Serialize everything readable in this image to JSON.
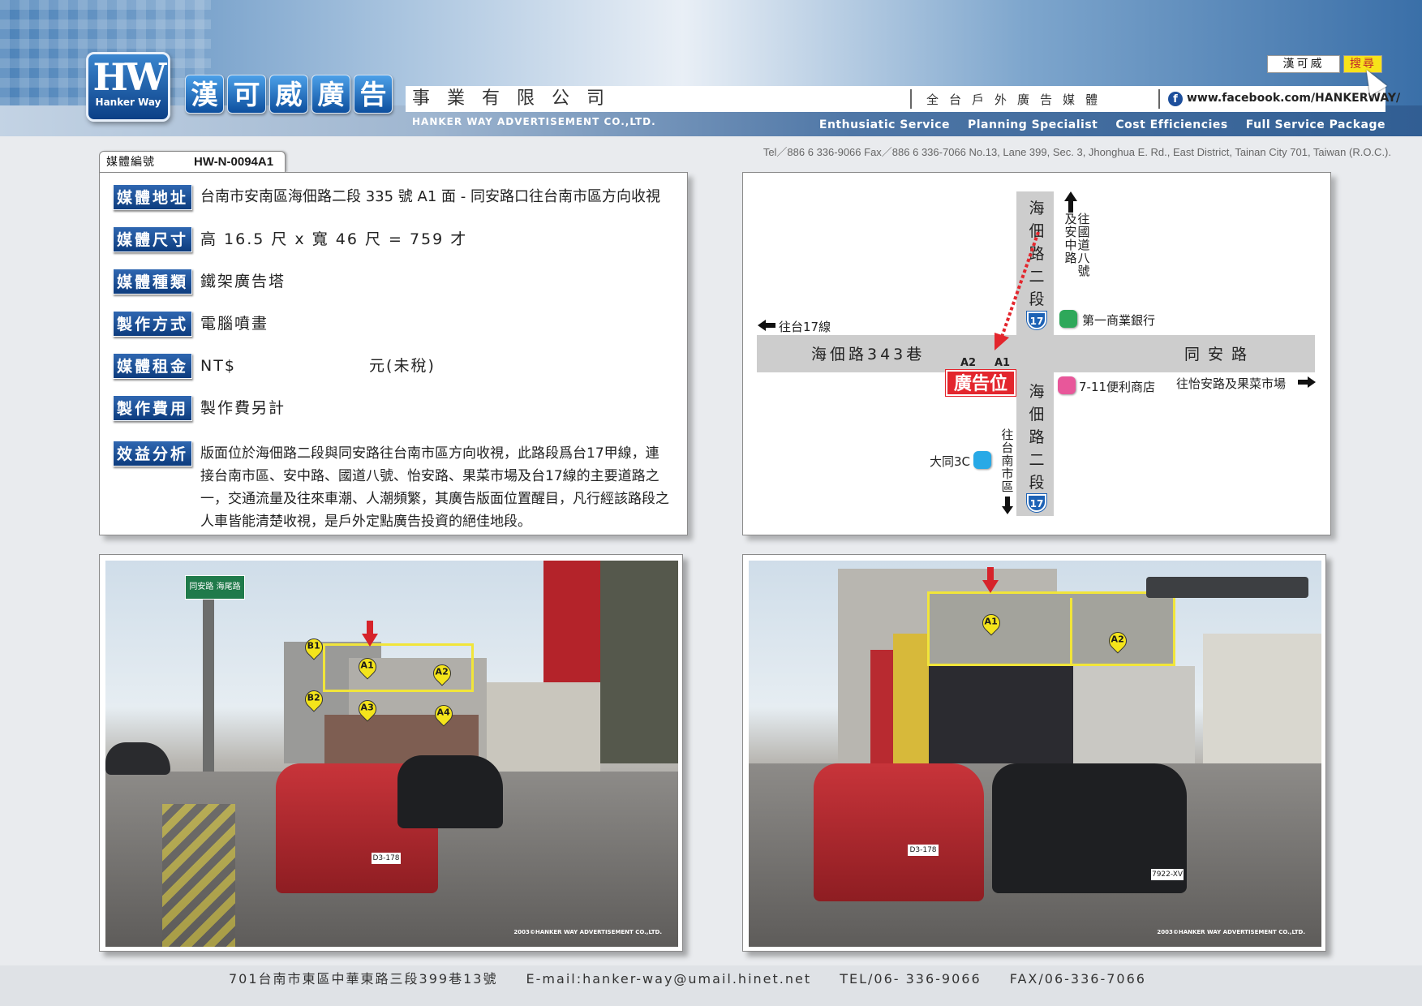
{
  "header": {
    "logo_text": "HW",
    "logo_sub": "Hanker Way",
    "brand_chars": [
      "漢",
      "可",
      "威",
      "廣",
      "告"
    ],
    "company_name": "事業有限公司",
    "company_en": "HANKER WAY ADVERTISEMENT CO.,LTD.",
    "tagline": "全台戶外廣告媒體",
    "facebook_url": "www.facebook.com/HANKERWAY/",
    "search_company": "漢可威",
    "search_button": "搜尋",
    "services": [
      "Enthusiatic Service",
      "Planning Specialist",
      "Cost Efficiencies",
      "Full Service Package"
    ],
    "contact": "Tel／886 6 336-9066   Fax／886 6 336-7066   No.13, Lane 399, Sec. 3, Jhonghua E. Rd., East District, Tainan City 701, Taiwan (R.O.C.)."
  },
  "media_id": {
    "label": "媒體編號",
    "value": "HW-N-0094A1"
  },
  "info": {
    "address_label": "媒體地址",
    "address": "台南市安南區海佃路二段 335 號 A1 面 - 同安路口往台南市區方向收視",
    "size_label": "媒體尺寸",
    "size": "高 16.5 尺 x 寬 46 尺 = 759 才",
    "type_label": "媒體種類",
    "type": "鐵架廣告塔",
    "method_label": "製作方式",
    "method": "電腦噴畫",
    "rent_label": "媒體租金",
    "rent_prefix": "NT$",
    "rent_suffix": "元(未稅)",
    "fee_label": "製作費用",
    "fee": "製作費另計",
    "analysis_label": "效益分析",
    "analysis": "版面位於海佃路二段與同安路往台南市區方向收視，此路段爲台17甲線，連接台南市區、安中路、國道八號、怡安路、果菜市場及台17線的主要道路之一，交通流量及往來車潮、人潮頻繁，其廣告版面位置醒目，凡行經該路段之人車皆能清楚收視，是戶外定點廣告投資的絕佳地段。"
  },
  "map": {
    "road_v_top": [
      "海",
      "佃",
      "路",
      "二",
      "段"
    ],
    "road_v_bottom": [
      "海",
      "佃",
      "路",
      "二",
      "段"
    ],
    "road_h_left": "海佃路343巷",
    "road_h_right": "同安路",
    "route_number": "17",
    "north_note": [
      "及",
      "往",
      "安",
      "國",
      "中",
      "道",
      "路",
      "八",
      "號"
    ],
    "west_note": "往台17線",
    "east_note": "往怡安路及果菜市場",
    "south_note": [
      "往",
      "台",
      "南",
      "市",
      "區"
    ],
    "poi_bank": "第一商業銀行",
    "poi_711": "7-11便利商店",
    "poi_datong": "大同3C",
    "ad_label": "廣告位置",
    "face_a1": "A1",
    "face_a2": "A2",
    "colors": {
      "bank": "#2ea85a",
      "seven": "#e8579a",
      "datong": "#28a9e6",
      "ad": "#e3262d"
    }
  },
  "photos": {
    "left": {
      "pins": [
        "B1",
        "A1",
        "A2",
        "B2",
        "A3",
        "A4"
      ],
      "sign_top": "同安路  海尾路",
      "plate": "D3-178",
      "copyright": "2003©HANKER WAY ADVERTISEMENT CO.,LTD."
    },
    "right": {
      "pins": [
        "A1",
        "A2"
      ],
      "plate": "D3-178",
      "plate2": "7922-XV",
      "copyright": "2003©HANKER WAY ADVERTISEMENT CO.,LTD."
    }
  },
  "footer": {
    "address": "701台南市東區中華東路三段399巷13號",
    "email": "E-mail:hanker-way@umail.hinet.net",
    "tel": "TEL/06- 336-9066",
    "fax": "FAX/06-336-7066"
  }
}
